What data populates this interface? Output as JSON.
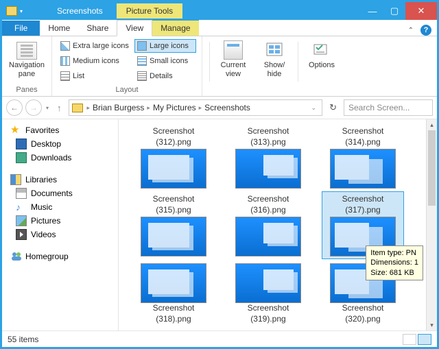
{
  "window": {
    "title": "Screenshots",
    "context_tab": "Picture Tools"
  },
  "tabs": {
    "file": "File",
    "home": "Home",
    "share": "Share",
    "view": "View",
    "manage": "Manage"
  },
  "ribbon": {
    "panes": {
      "nav": "Navigation\npane",
      "label": "Panes"
    },
    "layout": {
      "xl": "Extra large icons",
      "lg": "Large icons",
      "md": "Medium icons",
      "sm": "Small icons",
      "ls": "List",
      "dt": "Details",
      "label": "Layout"
    },
    "current": {
      "cur": "Current\nview",
      "sh": "Show/\nhide",
      "opt": "Options"
    }
  },
  "breadcrumb": [
    "Brian Burgess",
    "My Pictures",
    "Screenshots"
  ],
  "search": {
    "placeholder": "Search Screen..."
  },
  "sidebar": {
    "favorites": "Favorites",
    "desktop": "Desktop",
    "downloads": "Downloads",
    "libraries": "Libraries",
    "documents": "Documents",
    "music": "Music",
    "pictures": "Pictures",
    "videos": "Videos",
    "homegroup": "Homegroup"
  },
  "items": [
    {
      "name": "Screenshot (312).png"
    },
    {
      "name": "Screenshot (313).png"
    },
    {
      "name": "Screenshot (314).png"
    },
    {
      "name": "Screenshot (315).png"
    },
    {
      "name": "Screenshot (316).png"
    },
    {
      "name": "Screenshot (317).png"
    },
    {
      "name": "Screenshot (318).png"
    },
    {
      "name": "Screenshot (319).png"
    },
    {
      "name": "Screenshot (320).png"
    }
  ],
  "selected_index": 5,
  "tooltip": {
    "line1": "Item type: PN",
    "line2": "Dimensions: 1",
    "line3": "Size: 681 KB"
  },
  "status": {
    "count": "55 items"
  }
}
